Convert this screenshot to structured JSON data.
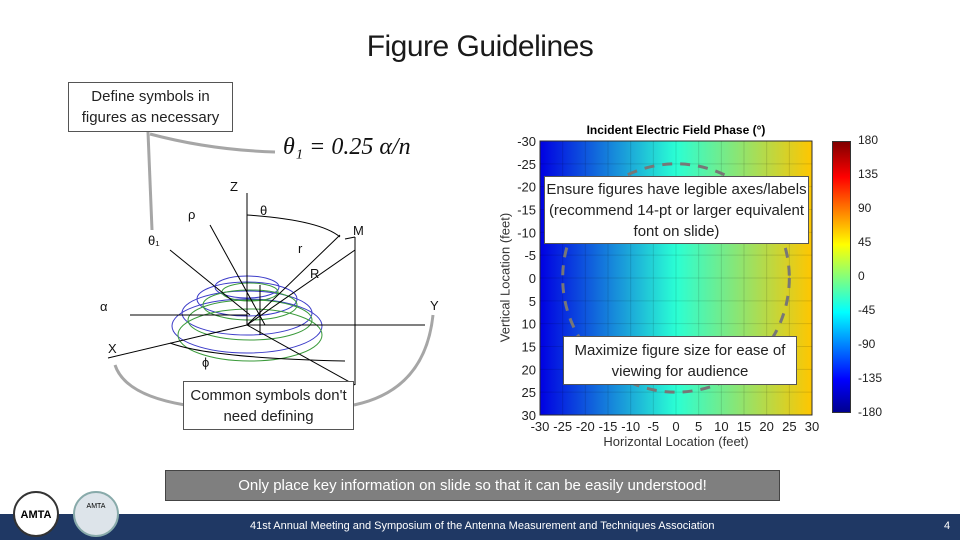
{
  "title": "Figure Guidelines",
  "callouts": {
    "define_symbols": "Define symbols in figures as necessary",
    "common_symbols": "Common symbols don't need defining",
    "legible_axes": "Ensure figures have legible axes/labels (recommend 14-pt or larger equivalent font on slide)",
    "maximize": "Maximize figure size for ease of viewing for audience"
  },
  "formula": "θ₁ = 0.25 α/n",
  "diagram_labels": {
    "z": "Z",
    "theta": "θ",
    "rho": "ρ",
    "theta1": "θ₁",
    "r": "r",
    "R": "R",
    "M": "M",
    "alpha": "α",
    "Y": "Y",
    "X": "X",
    "phi": "ϕ"
  },
  "bottom_note": "Only place key information on slide so that it can be easily understood!",
  "footer": {
    "text": "41st Annual Meeting and Symposium of the Antenna Measurement and Techniques Association",
    "page": "4",
    "logos": [
      "AMTA",
      "AMTA 2019"
    ]
  },
  "colors": {
    "footer_bg": "#1f3864",
    "note_bg": "#7f7f7f",
    "arrow": "#a6a6a6"
  },
  "chart_data": {
    "type": "heatmap",
    "title": "Incident Electric Field Phase (°)",
    "xlabel": "Horizontal Location (feet)",
    "ylabel": "Vertical Location (feet)",
    "xlim": [
      -30,
      30
    ],
    "ylim": [
      -30,
      30
    ],
    "xticks": [
      "-30",
      "-25",
      "-20",
      "-15",
      "-10",
      "-5",
      "0",
      "5",
      "10",
      "15",
      "20",
      "25",
      "30"
    ],
    "yticks": [
      "-30",
      "-25",
      "-20",
      "-15",
      "-10",
      "-5",
      "0",
      "5",
      "10",
      "15",
      "20",
      "25",
      "30"
    ],
    "y_reversed": true,
    "colorbar": {
      "range": [
        -180,
        180
      ],
      "ticks": [
        "180",
        "135",
        "90",
        "45",
        "0",
        "-45",
        "-90",
        "-135",
        "-180"
      ],
      "colormap": "jet"
    },
    "phase_vs_x": [
      {
        "x": -30,
        "phase": -145
      },
      {
        "x": 0,
        "phase": -30
      },
      {
        "x": 30,
        "phase": 65
      }
    ],
    "overlay": {
      "shape": "dashed circle",
      "center": [
        0,
        0
      ],
      "radius": 25
    },
    "grid": true
  }
}
